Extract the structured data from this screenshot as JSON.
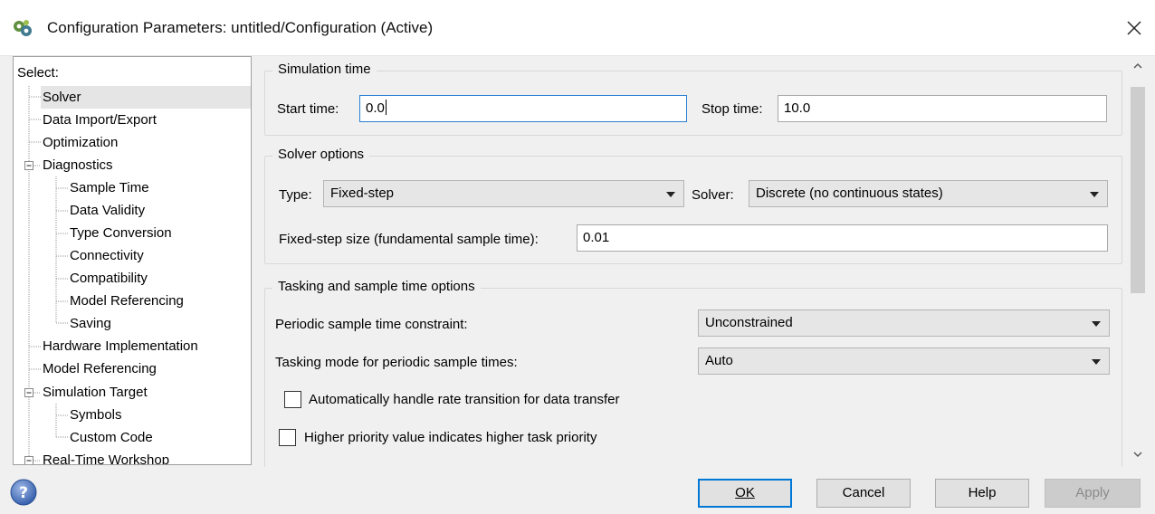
{
  "window": {
    "title": "Configuration Parameters: untitled/Configuration (Active)",
    "icon": "simulink-gear-icon"
  },
  "tree": {
    "header": "Select:",
    "items": [
      {
        "label": "Solver",
        "selected": true
      },
      {
        "label": "Data Import/Export"
      },
      {
        "label": "Optimization"
      },
      {
        "label": "Diagnostics",
        "expanded": true
      },
      {
        "label": "Sample Time"
      },
      {
        "label": "Data Validity"
      },
      {
        "label": "Type Conversion"
      },
      {
        "label": "Connectivity"
      },
      {
        "label": "Compatibility"
      },
      {
        "label": "Model Referencing"
      },
      {
        "label": "Saving"
      },
      {
        "label": "Hardware Implementation"
      },
      {
        "label": "Model Referencing"
      },
      {
        "label": "Simulation Target",
        "expanded": true
      },
      {
        "label": "Symbols"
      },
      {
        "label": "Custom Code"
      },
      {
        "label": "Real-Time Workshop",
        "expanded": true
      }
    ]
  },
  "simulation_time": {
    "title": "Simulation time",
    "start_label": "Start time:",
    "start_value": "0.0",
    "stop_label": "Stop time:",
    "stop_value": "10.0"
  },
  "solver_options": {
    "title": "Solver options",
    "type_label": "Type:",
    "type_value": "Fixed-step",
    "solver_label": "Solver:",
    "solver_value": "Discrete (no continuous states)",
    "step_label": "Fixed-step size (fundamental sample time):",
    "step_value": "0.01"
  },
  "tasking": {
    "title": "Tasking and sample time options",
    "periodic_label": "Periodic sample time constraint:",
    "periodic_value": "Unconstrained",
    "mode_label": "Tasking mode for periodic sample times:",
    "mode_value": "Auto",
    "check1_label": "Automatically handle rate transition for data transfer",
    "check1_checked": false,
    "check2_label": "Higher priority value indicates higher task priority",
    "check2_checked": false
  },
  "buttons": {
    "ok": "OK",
    "cancel": "Cancel",
    "help": "Help",
    "apply": "Apply"
  },
  "colors": {
    "focus_border": "#2a7fd4",
    "default_button_border": "#0078d7",
    "help_icon": "#3f6fb7"
  }
}
